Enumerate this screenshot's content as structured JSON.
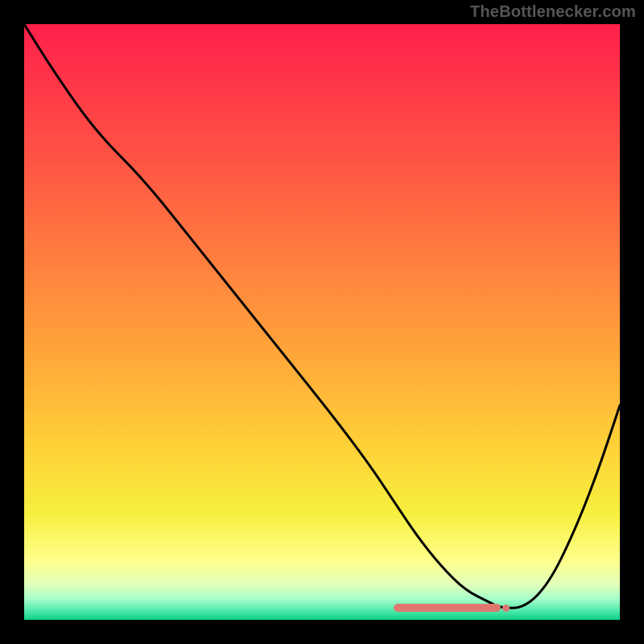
{
  "watermark": "TheBottlenecker.com",
  "chart_data": {
    "type": "line",
    "title": "",
    "xlabel": "",
    "ylabel": "",
    "xlim": [
      0,
      100
    ],
    "ylim": [
      0,
      100
    ],
    "series": [
      {
        "name": "curve",
        "x": [
          0,
          5,
          12,
          20,
          28,
          36,
          44,
          52,
          58,
          62,
          66,
          70,
          74,
          78,
          80,
          84,
          88,
          92,
          96,
          100
        ],
        "y": [
          100,
          92,
          82,
          74,
          64,
          54,
          44,
          34,
          26,
          20,
          14,
          9,
          5,
          3,
          2,
          2,
          6,
          14,
          24,
          36
        ]
      }
    ],
    "marker": {
      "x_start": 62,
      "x_end": 80,
      "y": 2
    },
    "gradient_stops": [
      {
        "offset": 0.0,
        "color": "#ff1f4b"
      },
      {
        "offset": 0.18,
        "color": "#ff4946"
      },
      {
        "offset": 0.38,
        "color": "#ff7a3f"
      },
      {
        "offset": 0.55,
        "color": "#ffa53a"
      },
      {
        "offset": 0.7,
        "color": "#ffcf38"
      },
      {
        "offset": 0.82,
        "color": "#f7ef3e"
      },
      {
        "offset": 0.9,
        "color": "#ffff8a"
      },
      {
        "offset": 0.94,
        "color": "#e2ffba"
      },
      {
        "offset": 0.965,
        "color": "#a4ffca"
      },
      {
        "offset": 0.985,
        "color": "#4fe8aa"
      },
      {
        "offset": 1.0,
        "color": "#0bd185"
      }
    ]
  }
}
